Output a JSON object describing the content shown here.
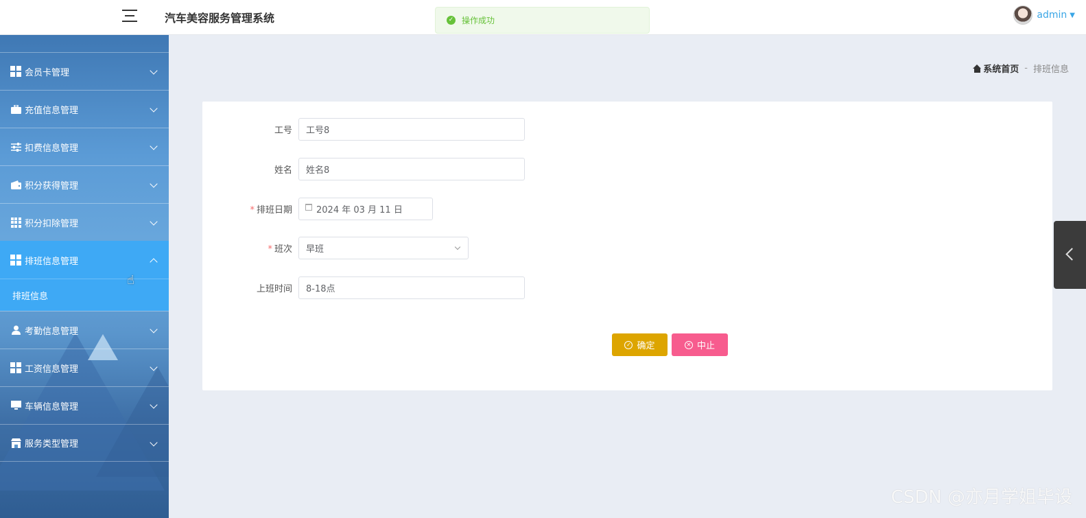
{
  "header": {
    "app_title": "汽车美容服务管理系统",
    "menu_toggle_icon": "hamburger-icon",
    "user": {
      "name": "admin",
      "avatar_icon": "avatar-icon",
      "caret_icon": "caret-down-icon"
    }
  },
  "toast": {
    "text": "操作成功",
    "icon": "check-circle-icon",
    "color": "#67c23a"
  },
  "sidebar": {
    "items": [
      {
        "label": "会员卡管理",
        "icon": "grid-icon",
        "expanded": false
      },
      {
        "label": "充值信息管理",
        "icon": "briefcase-icon",
        "expanded": false
      },
      {
        "label": "扣费信息管理",
        "icon": "sliders-icon",
        "expanded": false
      },
      {
        "label": "积分获得管理",
        "icon": "wallet-icon",
        "expanded": false
      },
      {
        "label": "积分扣除管理",
        "icon": "grid-nine-icon",
        "expanded": false
      },
      {
        "label": "排班信息管理",
        "icon": "grid-icon",
        "expanded": true,
        "active": true,
        "children": [
          {
            "label": "排班信息"
          }
        ]
      },
      {
        "label": "考勤信息管理",
        "icon": "user-icon",
        "expanded": false
      },
      {
        "label": "工资信息管理",
        "icon": "grid-icon",
        "expanded": false
      },
      {
        "label": "车辆信息管理",
        "icon": "monitor-icon",
        "expanded": false
      },
      {
        "label": "服务类型管理",
        "icon": "shop-icon",
        "expanded": false
      }
    ],
    "active_color": "#3ea9f5"
  },
  "breadcrumb": {
    "home": "系统首页",
    "separator": "-",
    "current": "排班信息"
  },
  "form": {
    "employee_no": {
      "label": "工号",
      "value": "工号8"
    },
    "name": {
      "label": "姓名",
      "value": "姓名8"
    },
    "schedule_date": {
      "label": "排班日期",
      "required": true,
      "value": "2024 年 03 月 11 日"
    },
    "shift": {
      "label": "班次",
      "required": true,
      "value": "早班"
    },
    "work_time": {
      "label": "上班时间",
      "value": "8-18点"
    },
    "confirm_button": "确定",
    "stop_button": "中止"
  },
  "colors": {
    "confirm": "#dda500",
    "stop": "#f75c8e",
    "background": "#e9edf4"
  },
  "watermark": "CSDN @亦月学姐毕设"
}
